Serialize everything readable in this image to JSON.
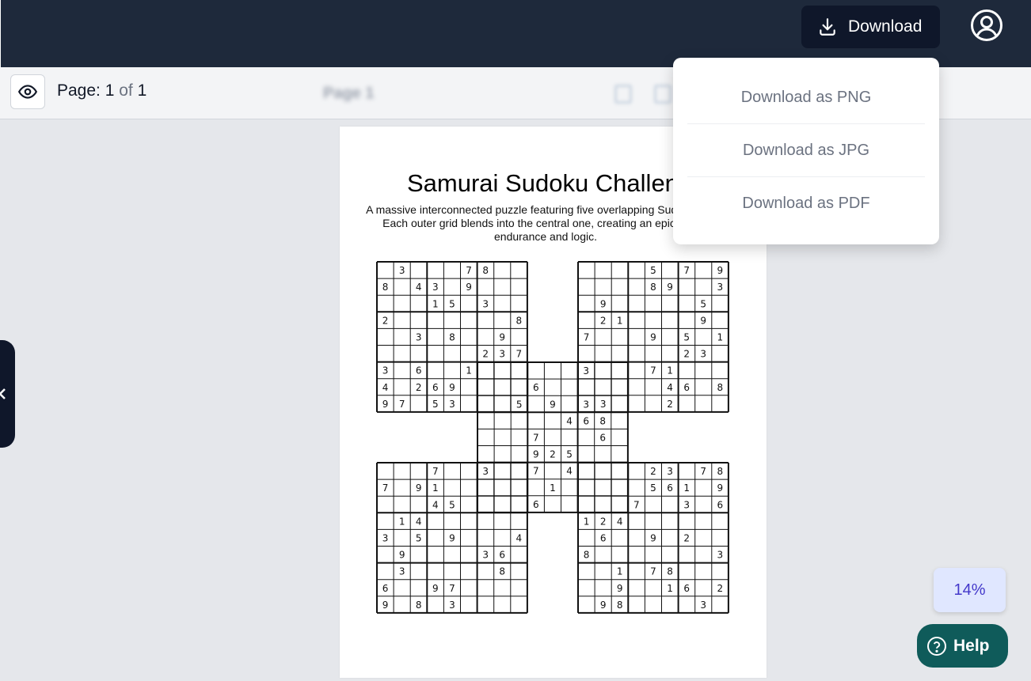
{
  "header": {
    "download_label": "Download",
    "download_icon": "download-icon",
    "avatar_icon": "user-circle-icon"
  },
  "toolbar": {
    "page_prefix": "Page: ",
    "page_current": "1",
    "page_of": "of",
    "page_total": "1",
    "page_name": "Page 1"
  },
  "dropdown": {
    "items": [
      "Download as PNG",
      "Download as JPG",
      "Download as PDF"
    ]
  },
  "document": {
    "title": "Samurai Sudoku Challenge",
    "description_lines": [
      "A massive interconnected puzzle featuring five overlapping Sudoku grids.",
      "Each outer grid blends into the central one, creating an epic test of",
      "endurance and logic."
    ],
    "grids": {
      "top_left": [
        "_3___78__",
        "8_43_9___",
        "___15_3__",
        "2_______8",
        "__3_8__9_",
        "______237",
        "3_6__1___",
        "4_269____",
        "97_53____"
      ],
      "top_right": [
        "____5_7_9",
        "____89__3",
        "_9_____5_",
        "_21____9_",
        "7___9_5_1",
        "______23_",
        "____71___",
        "_____46_8",
        "_3___2___"
      ],
      "center": [
        "______3__",
        "___6_____",
        "__5_9_3__",
        "_____468_",
        "___7___6_",
        "___925___",
        "3__7_4___",
        "____1____",
        "___6_____"
      ],
      "bottom_left": [
        "___7__3__",
        "7_91_____",
        "___45____",
        "_14______",
        "3_5_9___4",
        "_9____36_",
        "_3_____8_",
        "6__97____",
        "9_8_3____"
      ],
      "bottom_right": [
        "____23_78",
        "____561_9",
        "___7__3_6",
        "124______",
        "_6__9_2__",
        "8_______3",
        "__1_78___",
        "__9__16_2",
        "_98____3_"
      ]
    }
  },
  "zoom": {
    "value": "14%"
  },
  "help": {
    "label": "Help",
    "icon": "question-circle-icon"
  }
}
